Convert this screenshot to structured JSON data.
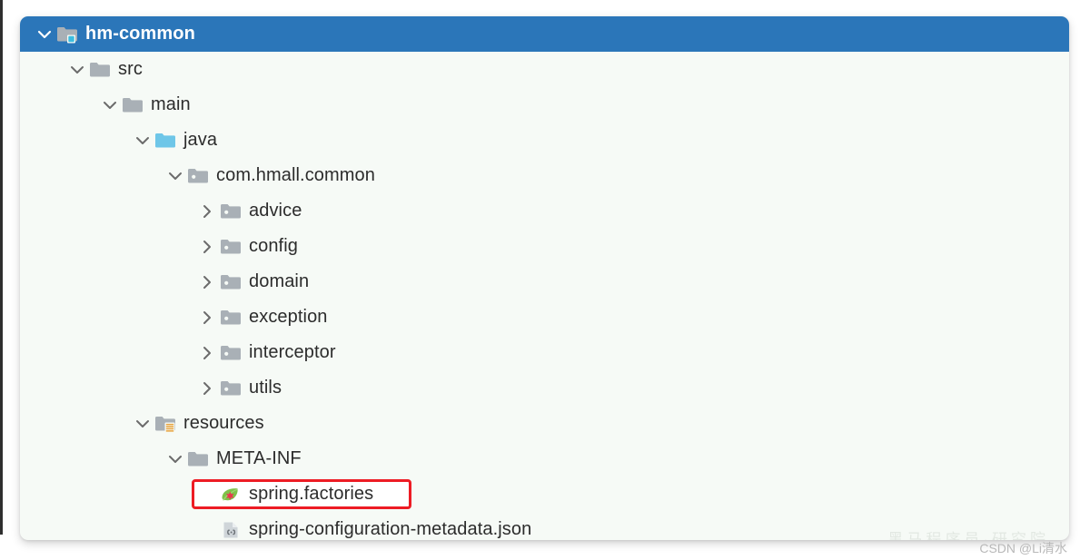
{
  "panel": {
    "background_color": "#f6faf6",
    "selection_color": "#2b76b9",
    "highlight_color": "#ed1c24"
  },
  "tree": {
    "rows": [
      {
        "label": "hm-common",
        "icon": "module-folder-icon",
        "chevron": "chevron-down-icon",
        "depth": 0,
        "selected": true,
        "boxed": false
      },
      {
        "label": "src",
        "icon": "folder-icon",
        "chevron": "chevron-down-icon",
        "depth": 1,
        "selected": false,
        "boxed": false
      },
      {
        "label": "main",
        "icon": "folder-icon",
        "chevron": "chevron-down-icon",
        "depth": 2,
        "selected": false,
        "boxed": false
      },
      {
        "label": "java",
        "icon": "source-root-folder-icon",
        "chevron": "chevron-down-icon",
        "depth": 3,
        "selected": false,
        "boxed": false
      },
      {
        "label": "com.hmall.common",
        "icon": "package-folder-icon",
        "chevron": "chevron-down-icon",
        "depth": 4,
        "selected": false,
        "boxed": false
      },
      {
        "label": "advice",
        "icon": "package-folder-icon",
        "chevron": "chevron-right-icon",
        "depth": 5,
        "selected": false,
        "boxed": false
      },
      {
        "label": "config",
        "icon": "package-folder-icon",
        "chevron": "chevron-right-icon",
        "depth": 5,
        "selected": false,
        "boxed": false
      },
      {
        "label": "domain",
        "icon": "package-folder-icon",
        "chevron": "chevron-right-icon",
        "depth": 5,
        "selected": false,
        "boxed": false
      },
      {
        "label": "exception",
        "icon": "package-folder-icon",
        "chevron": "chevron-right-icon",
        "depth": 5,
        "selected": false,
        "boxed": false
      },
      {
        "label": "interceptor",
        "icon": "package-folder-icon",
        "chevron": "chevron-right-icon",
        "depth": 5,
        "selected": false,
        "boxed": false
      },
      {
        "label": "utils",
        "icon": "package-folder-icon",
        "chevron": "chevron-right-icon",
        "depth": 5,
        "selected": false,
        "boxed": false
      },
      {
        "label": "resources",
        "icon": "resources-folder-icon",
        "chevron": "chevron-down-icon",
        "depth": 3,
        "selected": false,
        "boxed": false
      },
      {
        "label": "META-INF",
        "icon": "folder-icon",
        "chevron": "chevron-down-icon",
        "depth": 4,
        "selected": false,
        "boxed": false
      },
      {
        "label": "spring.factories",
        "icon": "spring-leaf-icon",
        "chevron": "none",
        "depth": 5,
        "selected": false,
        "boxed": true
      },
      {
        "label": "spring-configuration-metadata.json",
        "icon": "json-file-icon",
        "chevron": "none",
        "depth": 5,
        "selected": false,
        "boxed": false
      }
    ]
  },
  "watermarks": {
    "brand": "黑马程序员·研究院",
    "author": "CSDN @Li清水"
  }
}
